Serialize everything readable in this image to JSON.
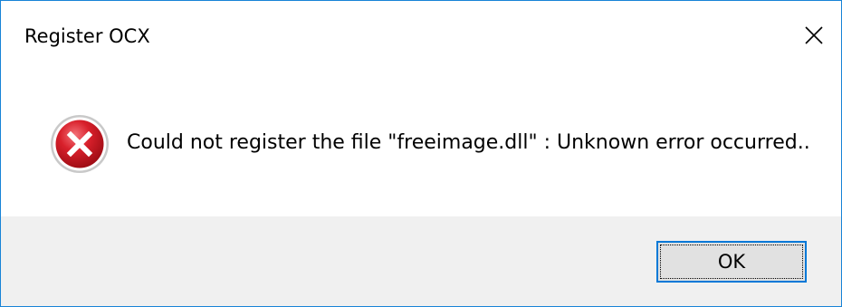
{
  "window": {
    "title": "Register OCX",
    "close_icon": "close-icon"
  },
  "content": {
    "icon": "error-icon",
    "message": "Could not register the file \"freeimage.dll\" : Unknown error occurred.."
  },
  "footer": {
    "ok_label": "OK"
  },
  "colors": {
    "border": "#1883d7",
    "footer_bg": "#f0f0f0",
    "button_bg": "#e1e1e1",
    "button_focus_border": "#0078d7",
    "error_red": "#c8102e"
  }
}
